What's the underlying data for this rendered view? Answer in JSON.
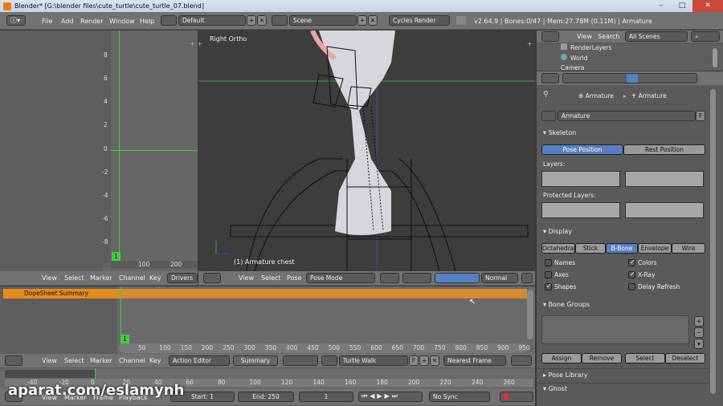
{
  "window": {
    "title": "Blender* [G:\\blender files\\cute_turtle\\cute_turtle_07.blend]",
    "minimize": "–",
    "maximize": "□",
    "close": "✕"
  },
  "top_header": {
    "menus": [
      "File",
      "Add",
      "Render",
      "Window",
      "Help"
    ],
    "layout": "Default",
    "scene": "Scene",
    "engine": "Cycles Render",
    "info": "v2.64.9 | Bones:0/47 | Mem:27.78M (0.11M) | Armature"
  },
  "driver_editor": {
    "y_ticks": [
      "8",
      "6",
      "4",
      "2",
      "0",
      "-2",
      "-4",
      "-6",
      "-8"
    ],
    "x_ticks": [
      "100",
      "200"
    ],
    "frame_marker": "1",
    "menus": [
      "View",
      "Select",
      "Marker",
      "Channel",
      "Key"
    ],
    "mode": "Drivers"
  },
  "viewport": {
    "view_label": "Right Ortho",
    "object_label": "(1) Armature chest",
    "menus": [
      "View",
      "Select",
      "Pose"
    ],
    "mode": "Pose Mode",
    "pivot": "Normal"
  },
  "dopesheet": {
    "summary": "DopeSheet Summary",
    "frame_marker": "1",
    "ticks": [
      "50",
      "100",
      "150",
      "200",
      "250",
      "300",
      "350",
      "400",
      "450",
      "500",
      "550",
      "600",
      "650",
      "700",
      "750",
      "800",
      "850",
      "900",
      "950"
    ],
    "menus": [
      "View",
      "Select",
      "Marker",
      "Channel",
      "Key"
    ],
    "mode": "Action Editor",
    "summary_btn": "Summary",
    "action": "Turtle Walk",
    "fake_user": "F",
    "snap": "Nearest Frame"
  },
  "timeline": {
    "ticks": [
      "-40",
      "-20",
      "0",
      "20",
      "40",
      "60",
      "80",
      "100",
      "120",
      "140",
      "160",
      "180",
      "200",
      "220",
      "240",
      "260"
    ],
    "menus": [
      "View",
      "Marker",
      "Frame",
      "Playback"
    ],
    "start": "Start: 1",
    "end": "End: 250",
    "current": "1",
    "sync": "No Sync"
  },
  "outliner": {
    "menus": [
      "View",
      "Search"
    ],
    "display": "All Scenes",
    "items": [
      "RenderLayers",
      "World",
      "Camera"
    ]
  },
  "properties": {
    "breadcrumb": [
      "Armature",
      "Armature"
    ],
    "datablock": "Armature",
    "datablock_f": "F",
    "skeleton": {
      "title": "Skeleton",
      "pose_position": "Pose Position",
      "rest_position": "Rest Position",
      "layers_label": "Layers:",
      "protected_label": "Protected Layers:"
    },
    "display": {
      "title": "Display",
      "modes": [
        "Octahedral",
        "Stick",
        "B-Bone",
        "Envelope",
        "Wire"
      ],
      "names": "Names",
      "colors": "Colors",
      "axes": "Axes",
      "xray": "X-Ray",
      "shapes": "Shapes",
      "delay": "Delay Refresh"
    },
    "bone_groups": {
      "title": "Bone Groups",
      "assign": "Assign",
      "remove": "Remove",
      "select": "Select",
      "deselect": "Deselect"
    },
    "pose_library": "Pose Library",
    "ghost": "Ghost"
  },
  "watermark": "aparat.com/eslamynh"
}
